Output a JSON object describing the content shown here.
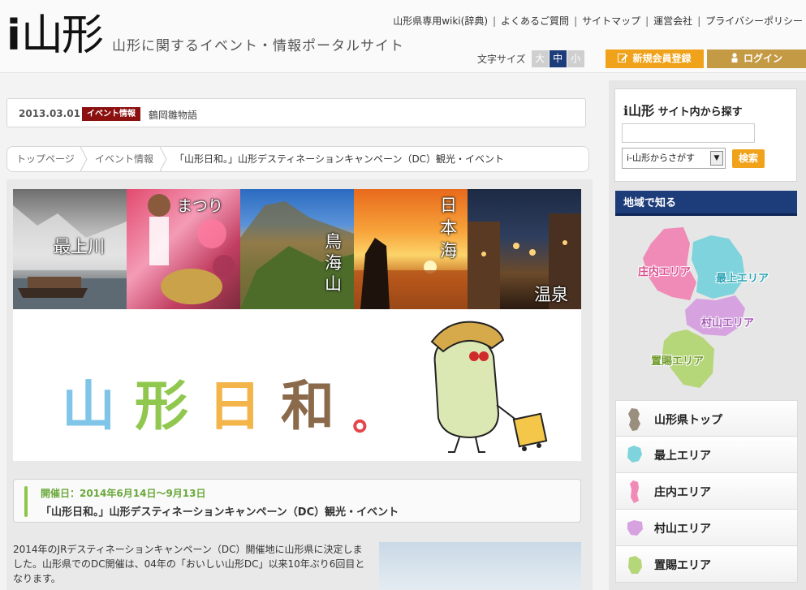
{
  "header": {
    "logo_prefix": "i",
    "logo_text": "山形",
    "tagline": "山形に関するイベント・情報ポータルサイト",
    "util_links": [
      "山形県専用wiki(辞典)",
      "よくあるご質問",
      "サイトマップ",
      "運営会社",
      "プライバシーポリシー"
    ],
    "fontsize_label": "文字サイズ",
    "fontsize_options": [
      "大",
      "中",
      "小"
    ],
    "register_label": "新規会員登録",
    "login_label": "ログイン"
  },
  "ticker": {
    "date": "2013.03.01",
    "badge": "イベント情報",
    "title": "鶴岡雛物語"
  },
  "breadcrumb": [
    "トップページ",
    "イベント情報",
    "「山形日和。」山形デスティネーションキャンペーン（DC）観光・イベント"
  ],
  "photos": [
    {
      "label": "最上川"
    },
    {
      "label": "まつり"
    },
    {
      "label": "鳥海山"
    },
    {
      "label": "日本海"
    },
    {
      "label": "温泉"
    }
  ],
  "banner": {
    "chars": [
      "山",
      "形",
      "日",
      "和",
      "。"
    ],
    "colors": {
      "c1": "#7fc5e8",
      "c2": "#90c74e",
      "c3": "#f3b44a",
      "c4": "#8a6a4a",
      "c5": "#e4464b"
    }
  },
  "event": {
    "date": "開催日：2014年6月14日〜9月13日",
    "name": "「山形日和。」山形デスティネーションキャンペーン（DC）観光・イベント"
  },
  "intro": {
    "text": "2014年のJRデスティネーションキャンペーン（DC）開催地に山形県に決定しました。山形県でのDC開催は、04年の「おいしい山形DC」以来10年ぶり6回目となります。"
  },
  "search": {
    "title_brand": "i山形",
    "title_rest": " サイト内から探す",
    "input_value": "",
    "select_value": "i-山形からさがす",
    "button_label": "検索"
  },
  "region": {
    "heading": "地域で知る",
    "map_labels": {
      "shonai": "庄内エリア",
      "mogami": "最上エリア",
      "murayama": "村山エリア",
      "okitama": "置賜エリア"
    },
    "areas": [
      {
        "label": "山形県トップ",
        "color": "#9a8f7e"
      },
      {
        "label": "最上エリア",
        "color": "#7fd3dc"
      },
      {
        "label": "庄内エリア",
        "color": "#f08bb8"
      },
      {
        "label": "村山エリア",
        "color": "#d6a3e0"
      },
      {
        "label": "置賜エリア",
        "color": "#b6d67a"
      }
    ]
  }
}
